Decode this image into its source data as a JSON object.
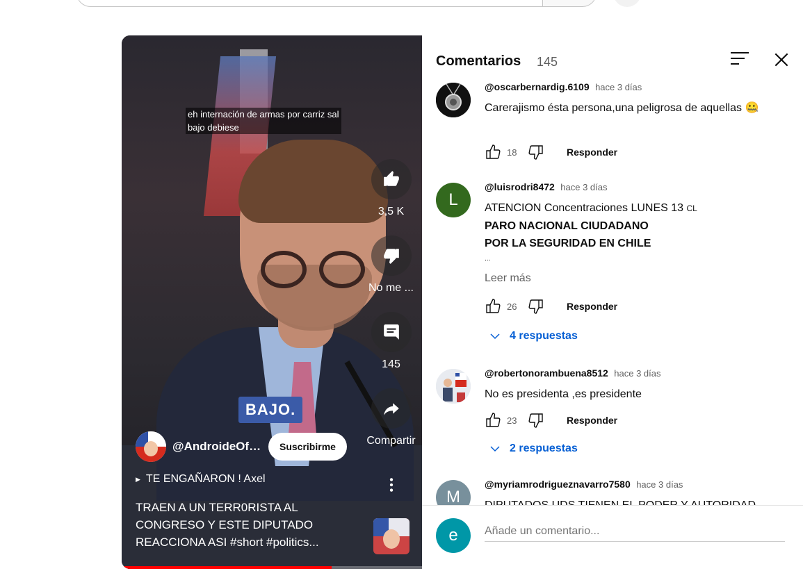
{
  "video": {
    "subtitle_line1": "eh internación de armas por carriz sal",
    "subtitle_line2": "bajo debiese",
    "caption_overlay": "BAJO.",
    "likes": "3,5 K",
    "dislike_label": "No me ...",
    "comments_count": "145",
    "share_label": "Compartir",
    "channel_name": "@AndroideOfficial",
    "subscribe_label": "Suscribirme",
    "playlist_title": "TE ENGAÑARON ! Axel",
    "title": "TRAEN A UN TERR0RISTA AL CONGRESO Y ESTE DIPUTADO REACCIONA ASI #short #politics..."
  },
  "panel": {
    "title": "Comentarios",
    "count": "145",
    "comments": [
      {
        "handle": "@oscarbernardig.6109",
        "time": "hace 3 días",
        "text": "Carerajismo ésta persona,una peligrosa de aquellas 🤐",
        "likes": "18",
        "reply_label": "Responder",
        "avatar_letter": "",
        "avatar_color": "#111111"
      },
      {
        "handle": "@luisrodri8472",
        "time": "hace 3 días",
        "text_line1": "ATENCION Concentraciones LUNES 13 ",
        "text_line1_small": "CL",
        "text_line2": "PARO NACIONAL CIUDADANO",
        "text_line3": "POR LA SEGURIDAD EN CHILE",
        "text_line4": "...",
        "read_more": "Leer más",
        "likes": "26",
        "reply_label": "Responder",
        "replies": "4 respuestas",
        "avatar_letter": "L",
        "avatar_color": "#33691e"
      },
      {
        "handle": "@robertonorambuena8512",
        "time": "hace 3 días",
        "text": "No es presidenta ,es presidente",
        "likes": "23",
        "reply_label": "Responder",
        "replies": "2 respuestas",
        "avatar_letter": "",
        "avatar_color": "#dfe3ea"
      },
      {
        "handle": "@myriamrodrigueznavarro7580",
        "time": "hace 3 días",
        "text": "DIPUTADOS UDS TIENEN EL PODER Y AUTORIDAD",
        "avatar_letter": "M",
        "avatar_color": "#78909c"
      }
    ],
    "add_comment": {
      "avatar_letter": "e",
      "avatar_color": "#0097a7",
      "placeholder": "Añade un comentario..."
    }
  }
}
